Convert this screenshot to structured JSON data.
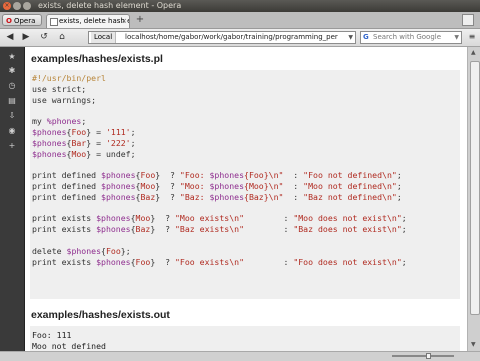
{
  "window": {
    "title": "exists, delete hash element - Opera"
  },
  "tabs": {
    "opera_menu_label": "Opera",
    "active_tab_label": "exists, delete hash e",
    "new_tab": "+"
  },
  "toolbar": {
    "back": "◀",
    "forward": "▶",
    "rewind": "↺",
    "home": "⌂",
    "address_badge": "Local",
    "url": "localhost/home/gabor/work/gabor/training/programming_per",
    "search_placeholder": "Search with Google"
  },
  "sections": [
    {
      "heading": "examples/hashes/exists.pl"
    },
    {
      "heading": "examples/hashes/exists.out"
    }
  ],
  "output_lines": [
    "Foo: 111",
    "Moo not defined"
  ],
  "colors": {
    "accent": "#cc0f16",
    "code_bg": "#efefef",
    "variable": "#8f2f8f",
    "string": "#b02a20",
    "comment": "#b8863b"
  }
}
